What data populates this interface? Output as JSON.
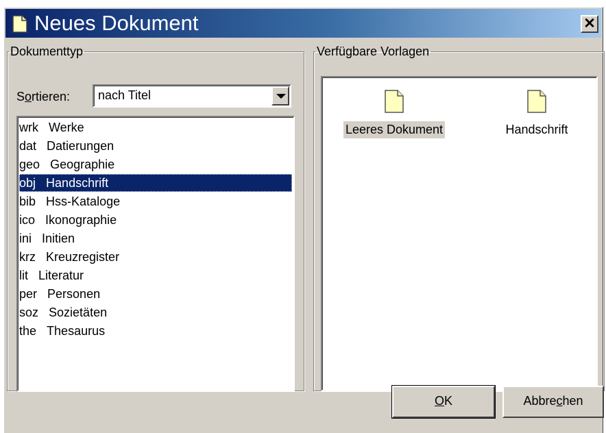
{
  "window": {
    "title": "Neues Dokument",
    "close_label": "✕"
  },
  "doc_type": {
    "legend": "Dokumenttyp",
    "sort_label_pre": "S",
    "sort_label_ul": "o",
    "sort_label_post": "rtieren:",
    "sort_value": "nach Titel",
    "items": [
      {
        "code": "wrk",
        "label": "Werke"
      },
      {
        "code": "dat",
        "label": "Datierungen"
      },
      {
        "code": "geo",
        "label": "Geographie"
      },
      {
        "code": "obj",
        "label": "Handschrift"
      },
      {
        "code": "bib",
        "label": "Hss-Kataloge"
      },
      {
        "code": "ico",
        "label": "Ikonographie"
      },
      {
        "code": "ini",
        "label": "Initien"
      },
      {
        "code": "krz",
        "label": "Kreuzregister"
      },
      {
        "code": "lit",
        "label": "Literatur"
      },
      {
        "code": "per",
        "label": "Personen"
      },
      {
        "code": "soz",
        "label": "Sozietäten"
      },
      {
        "code": "the",
        "label": "Thesaurus"
      }
    ],
    "selected_index": 3
  },
  "templates": {
    "legend": "Verfügbare Vorlagen",
    "items": [
      {
        "label": "Leeres Dokument",
        "icon": "document-icon"
      },
      {
        "label": "Handschrift",
        "icon": "document-icon"
      }
    ]
  },
  "buttons": {
    "ok_ul": "O",
    "ok_rest": "K",
    "cancel_pre": "Abbre",
    "cancel_ul": "c",
    "cancel_post": "hen"
  },
  "colors": {
    "selection": "#0a246a",
    "face": "#d4d0c8",
    "document_icon_fill": "#ffffc0"
  }
}
